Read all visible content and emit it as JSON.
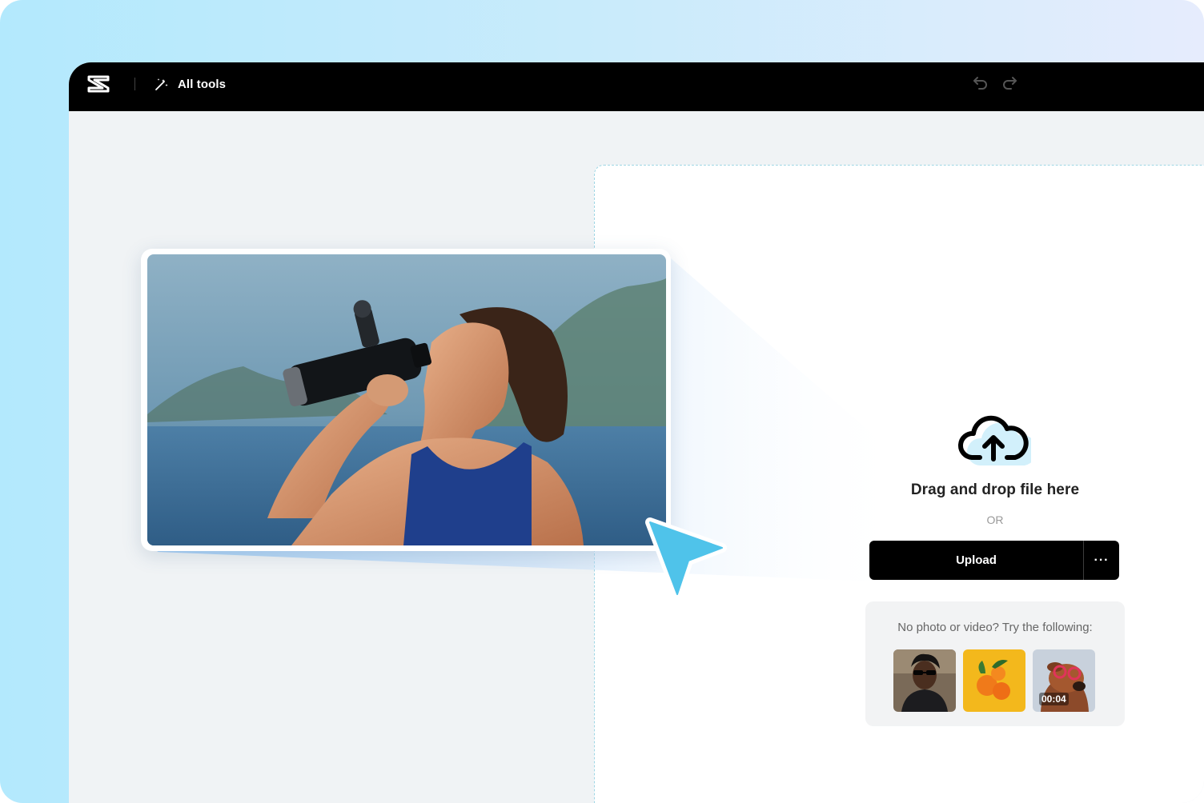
{
  "topbar": {
    "logo_icon": "capcut-logo-icon",
    "all_tools_label": "All tools",
    "all_tools_icon": "magic-wand-icon",
    "undo_icon": "undo-icon",
    "redo_icon": "redo-icon"
  },
  "dropzone": {
    "upload_icon": "cloud-upload-icon",
    "drag_text": "Drag and drop file here",
    "or_text": "OR",
    "upload_label": "Upload",
    "more_label": "···",
    "samples_label": "No photo or video? Try the following:",
    "samples": [
      {
        "kind": "photo",
        "subject": "man with sunglasses"
      },
      {
        "kind": "photo",
        "subject": "oranges on yellow"
      },
      {
        "kind": "video",
        "subject": "dog with sunglasses",
        "duration": "00:04"
      }
    ]
  },
  "preview": {
    "subject": "woman drinking from bottle by the sea"
  },
  "colors": {
    "background_gradient_start": "#b3e9fd",
    "accent_cursor": "#4fc3ea",
    "topbar": "#000000",
    "upload_button": "#000000"
  }
}
